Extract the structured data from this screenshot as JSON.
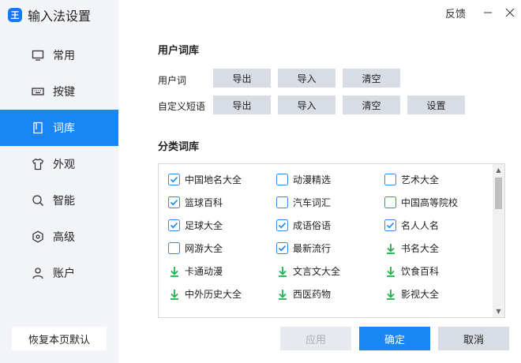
{
  "app": {
    "title": "输入法设置",
    "logo_text": "王"
  },
  "topbar": {
    "feedback": "反馈",
    "minimize": "—",
    "close": "✕"
  },
  "sidebar": {
    "items": [
      {
        "label": "常用",
        "icon": "monitor-icon",
        "active": false
      },
      {
        "label": "按键",
        "icon": "keyboard-icon",
        "active": false
      },
      {
        "label": "词库",
        "icon": "book-icon",
        "active": true
      },
      {
        "label": "外观",
        "icon": "shirt-icon",
        "active": false
      },
      {
        "label": "智能",
        "icon": "search-icon",
        "active": false
      },
      {
        "label": "高级",
        "icon": "hexagon-icon",
        "active": false
      },
      {
        "label": "账户",
        "icon": "user-icon",
        "active": false
      }
    ],
    "reset_label": "恢复本页默认"
  },
  "user_dict": {
    "title": "用户词库",
    "row1": {
      "label": "用户词",
      "buttons": [
        "导出",
        "导入",
        "清空"
      ]
    },
    "row2": {
      "label": "自定义短语",
      "buttons": [
        "导出",
        "导入",
        "清空",
        "设置"
      ]
    }
  },
  "category_dict": {
    "title": "分类词库",
    "items": [
      {
        "label": "中国地名大全",
        "state": "checked"
      },
      {
        "label": "动漫精选",
        "state": "unchecked"
      },
      {
        "label": "艺术大全",
        "state": "unchecked"
      },
      {
        "label": "篮球百科",
        "state": "checked"
      },
      {
        "label": "汽车词汇",
        "state": "unchecked"
      },
      {
        "label": "中国高等院校",
        "state": "unchecked"
      },
      {
        "label": "足球大全",
        "state": "checked"
      },
      {
        "label": "成语俗语",
        "state": "checked"
      },
      {
        "label": "名人人名",
        "state": "checked"
      },
      {
        "label": "网游大全",
        "state": "unchecked"
      },
      {
        "label": "最新流行",
        "state": "checked"
      },
      {
        "label": "书名大全",
        "state": "download"
      },
      {
        "label": "卡通动漫",
        "state": "download"
      },
      {
        "label": "文言文大全",
        "state": "download"
      },
      {
        "label": "饮食百科",
        "state": "download"
      },
      {
        "label": "中外历史大全",
        "state": "download"
      },
      {
        "label": "西医药物",
        "state": "download"
      },
      {
        "label": "影视大全",
        "state": "download"
      }
    ]
  },
  "footer": {
    "apply": "应用",
    "ok": "确定",
    "cancel": "取消"
  },
  "colors": {
    "accent": "#1a86f5",
    "download": "#22b14c",
    "sidebar_bg": "#f2f4f7",
    "button_bg": "#d8dde5"
  }
}
